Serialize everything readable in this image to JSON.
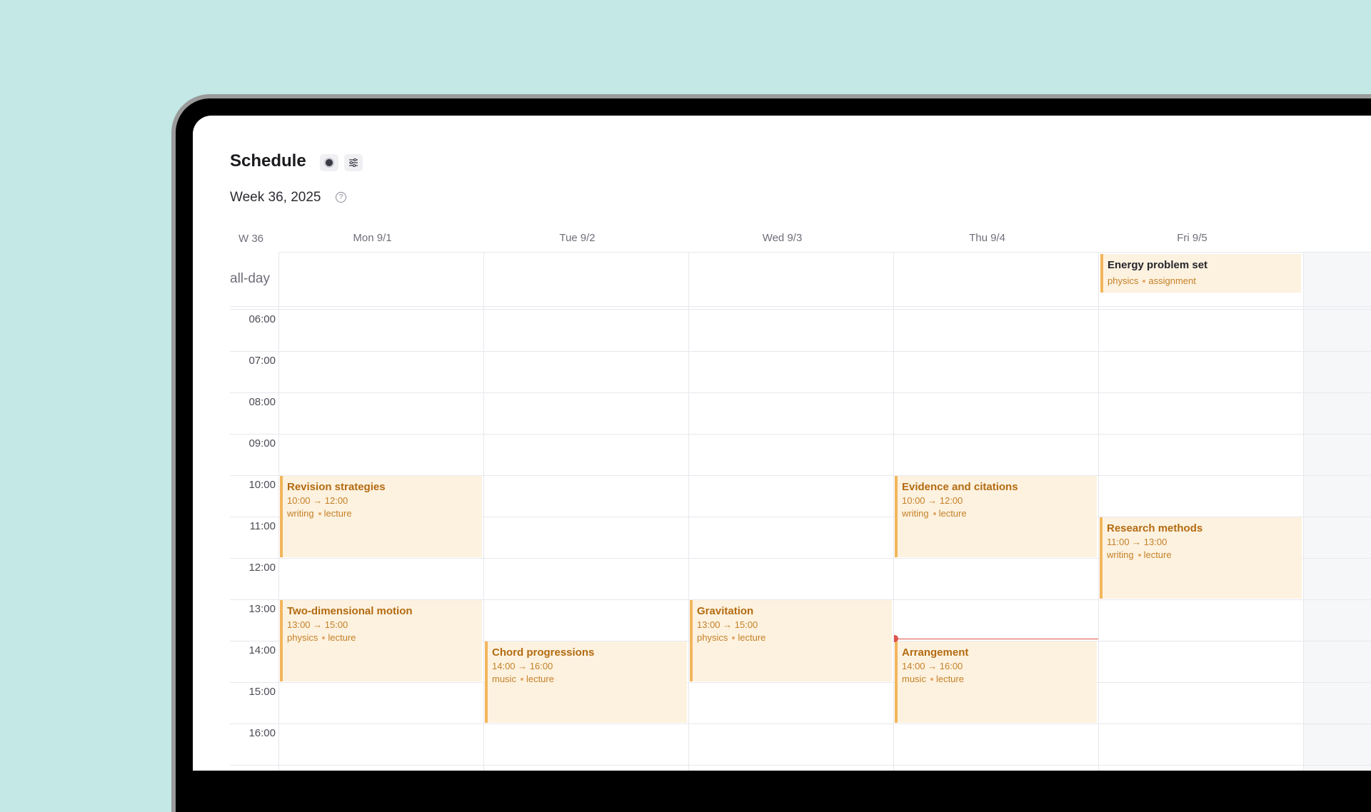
{
  "header": {
    "title": "Schedule",
    "record_icon": "record-dot-icon",
    "settings_icon": "sliders-icon",
    "week_title": "Week 36, 2025",
    "help_glyph": "?"
  },
  "calendar": {
    "week_label": "W 36",
    "allday_label": "all-day",
    "days": [
      "Mon 9/1",
      "Tue 9/2",
      "Wed 9/3",
      "Thu 9/4",
      "Fri 9/5"
    ],
    "hours": [
      "06:00",
      "07:00",
      "08:00",
      "09:00",
      "10:00",
      "11:00",
      "12:00",
      "13:00",
      "14:00",
      "15:00",
      "16:00"
    ],
    "allday_events": [
      {
        "title": "Energy problem set",
        "tag1": "physics",
        "tag2": "assignment"
      }
    ],
    "events": [
      {
        "title": "Revision strategies",
        "time": "10:00 → 12:00",
        "tag1": "writing",
        "tag2": "lecture"
      },
      {
        "title": "Evidence and citations",
        "time": "10:00 → 12:00",
        "tag1": "writing",
        "tag2": "lecture"
      },
      {
        "title": "Research methods",
        "time": "11:00 → 13:00",
        "tag1": "writing",
        "tag2": "lecture"
      },
      {
        "title": "Two-dimensional motion",
        "time": "13:00 → 15:00",
        "tag1": "physics",
        "tag2": "lecture"
      },
      {
        "title": "Gravitation",
        "time": "13:00 → 15:00",
        "tag1": "physics",
        "tag2": "lecture"
      },
      {
        "title": "Chord progressions",
        "time": "14:00 → 16:00",
        "tag1": "music",
        "tag2": "lecture"
      },
      {
        "title": "Arrangement",
        "time": "14:00 → 16:00",
        "tag1": "music",
        "tag2": "lecture"
      }
    ]
  },
  "colors": {
    "background": "#c3e8e6",
    "event_fill": "#fdf2df",
    "event_accent": "#f2b65c",
    "event_text": "#b36b12",
    "now_indicator": "#e0544d"
  }
}
